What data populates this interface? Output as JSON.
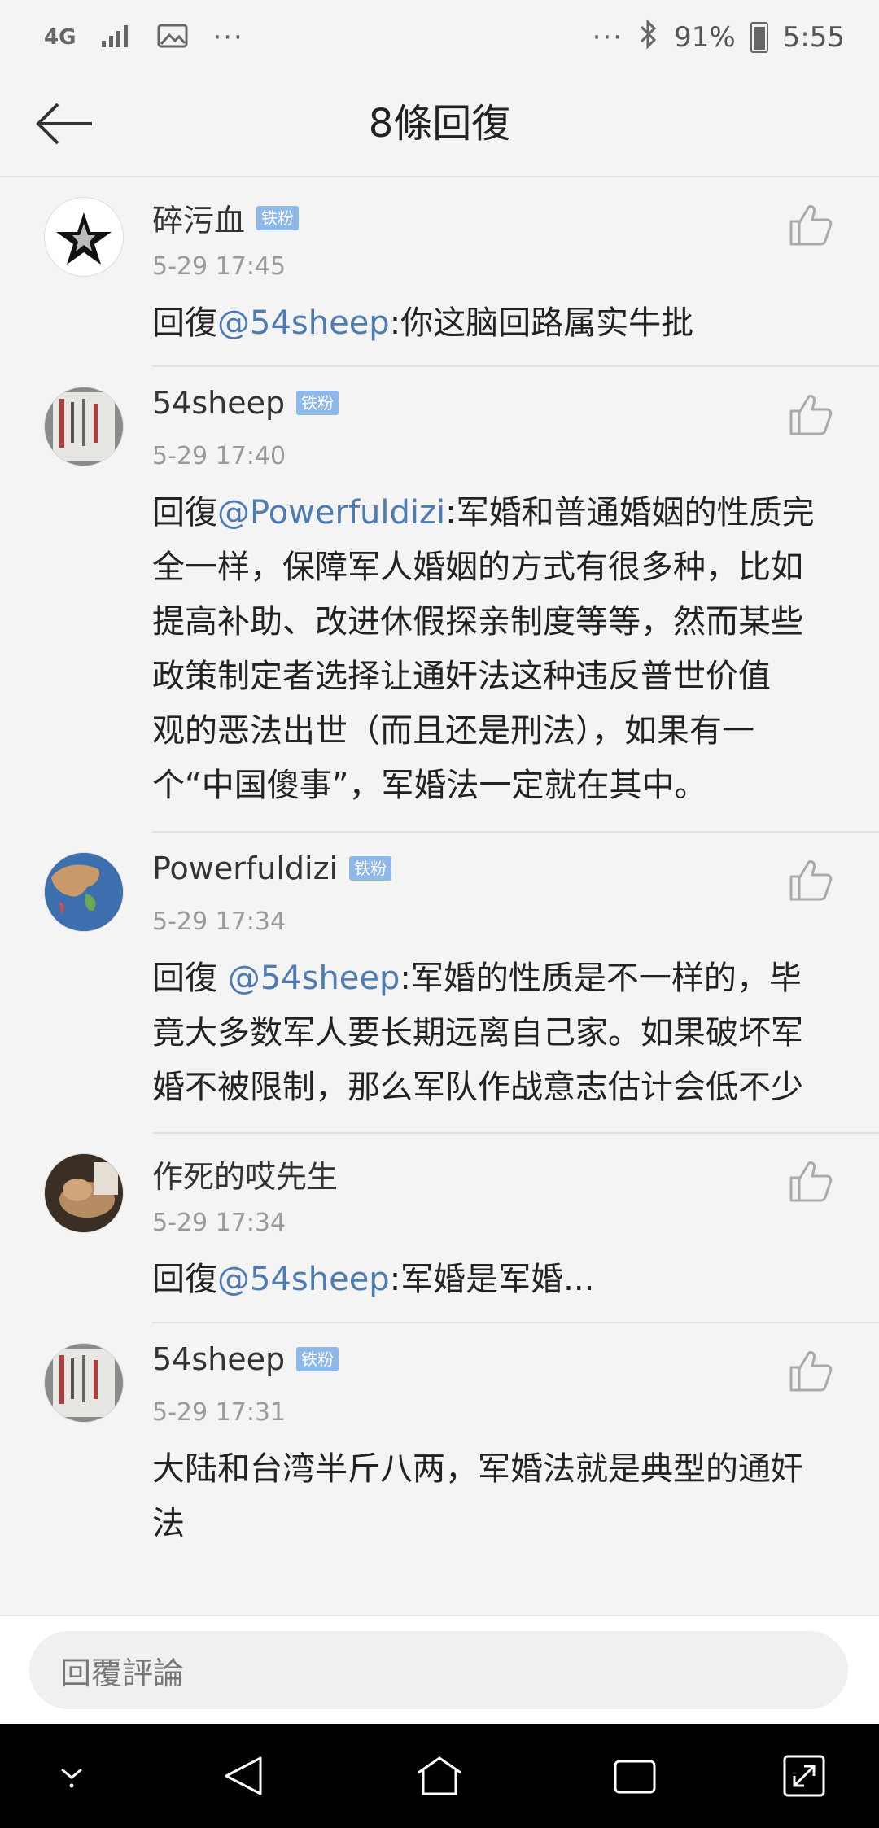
{
  "status_bar": {
    "network": "4G",
    "battery": "91%",
    "time": "5:55",
    "icons": [
      "signal-icon",
      "image-icon",
      "more-icon",
      "bluetooth-icon",
      "battery-icon"
    ]
  },
  "header": {
    "title": "8條回復",
    "back_icon": "back-arrow-icon"
  },
  "comments": [
    {
      "username": "碎污血",
      "badge": "铁粉",
      "time": "5-29 17:45",
      "prefix": "回復",
      "mention": "@54sheep",
      "text": ":你这脑回路属实牛批"
    },
    {
      "username": "54sheep",
      "badge": "铁粉",
      "time": "5-29 17:40",
      "prefix": "回復",
      "mention": "@Powerfuldizi",
      "lines": [
        ":军婚和普通婚姻的性质完",
        "全一样，保障军人婚姻的方式有很多种，比如",
        "提高补助、改进休假探亲制度等等，然而某些",
        "政策制定者选择让通奸法这种违反普世价值",
        "观的恶法出世（而且还是刑法），如果有一",
        "个“中国傻事”，军婚法一定就在其中。"
      ]
    },
    {
      "username": "Powerfuldizi",
      "badge": "铁粉",
      "time": "5-29 17:34",
      "prefix": "回復 ",
      "mention": "@54sheep",
      "lines": [
        ":军婚的性质是不一样的，毕",
        "竟大多数军人要长期远离自己家。如果破坏军",
        "婚不被限制，那么军队作战意志估计会低不少"
      ]
    },
    {
      "username": "作死的哎先生",
      "badge": "",
      "time": "5-29 17:34",
      "prefix": "回復",
      "mention": "@54sheep",
      "text": ":军婚是军婚..."
    },
    {
      "username": "54sheep",
      "badge": "铁粉",
      "time": "5-29 17:31",
      "lines": [
        "大陆和台湾半斤八两，军婚法就是典型的通奸",
        "法"
      ]
    }
  ],
  "reply_bar": {
    "placeholder": "回覆評論"
  },
  "nav_bar": {
    "icons": [
      "collapse-icon",
      "back-icon",
      "home-icon",
      "recents-icon",
      "expand-icon"
    ]
  },
  "colors": {
    "mention": "#4f7bb3",
    "badge": "#8fb8ea",
    "background": "#f4f4f4"
  }
}
